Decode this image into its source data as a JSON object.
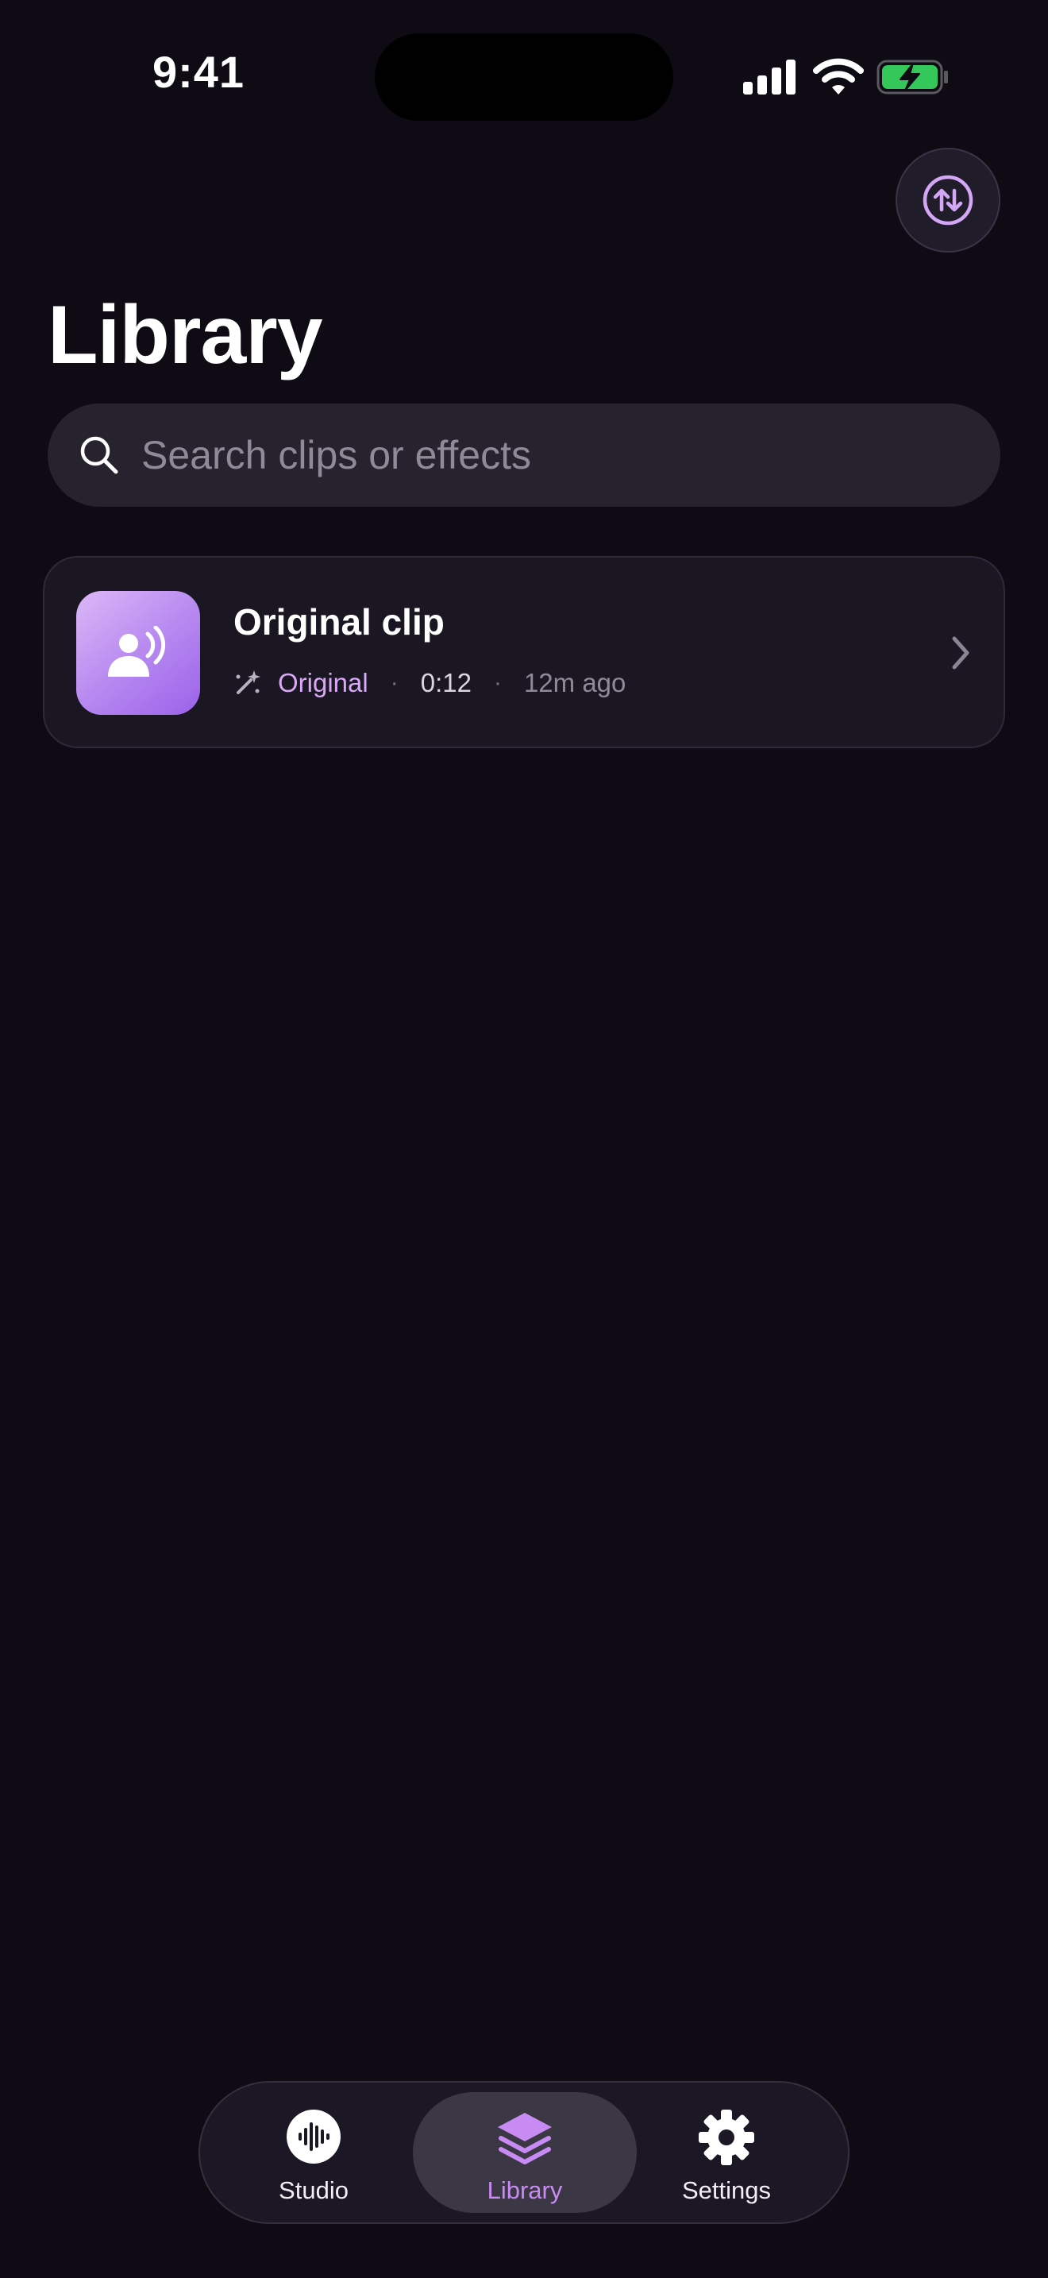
{
  "status_bar": {
    "time": "9:41",
    "icons": [
      "cellular-signal-icon",
      "wifi-icon",
      "battery-charging-icon"
    ],
    "battery_color": "#34c759"
  },
  "header": {
    "sort_icon": "sort-arrows-icon",
    "title": "Library"
  },
  "search": {
    "icon": "search-icon",
    "placeholder": "Search clips or effects",
    "value": ""
  },
  "clips": [
    {
      "title": "Original clip",
      "thumbnail_icon": "person-speaking-icon",
      "effect_icon": "magic-wand-icon",
      "effect": "Original",
      "separator": "·",
      "duration": "0:12",
      "age": "12m ago",
      "chevron_icon": "chevron-right-icon"
    }
  ],
  "tab_bar": {
    "tabs": [
      {
        "label": "Studio",
        "icon": "waveform-icon",
        "selected": false
      },
      {
        "label": "Library",
        "icon": "stack-layers-icon",
        "selected": true
      },
      {
        "label": "Settings",
        "icon": "gear-icon",
        "selected": false
      }
    ]
  },
  "colors": {
    "background": "#0e0b15",
    "accent": "#c88af3",
    "card": "#1a1622"
  }
}
